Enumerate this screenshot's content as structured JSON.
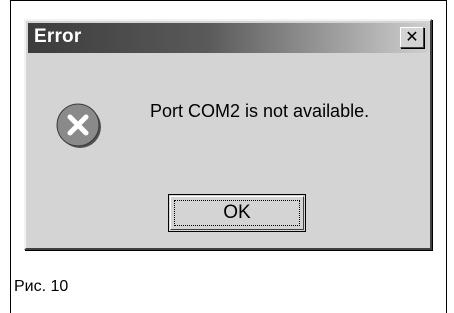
{
  "dialog": {
    "title": "Error",
    "close_glyph": "✕",
    "icon": "error-x-icon",
    "message": "Port COM2 is not available.",
    "ok_label": "OK"
  },
  "figure": {
    "caption": "Рис. 10"
  },
  "colors": {
    "dialog_face": "#d4d4d4",
    "title_bar_start": "#3c3c3c",
    "title_bar_end": "#cfcfcf",
    "icon_fill": "#8a8a8a"
  }
}
